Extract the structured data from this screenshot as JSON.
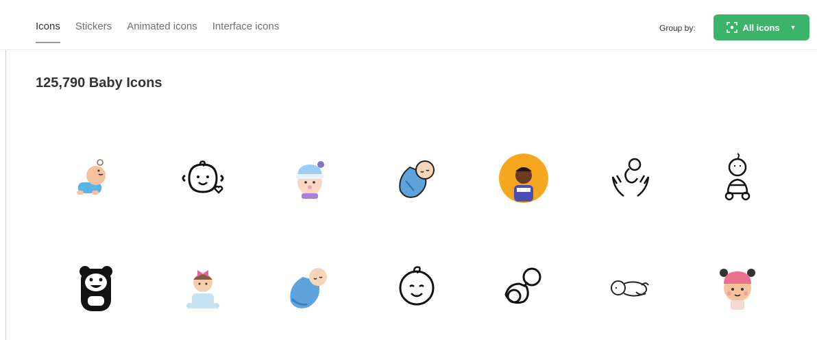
{
  "tabs": [
    {
      "label": "Icons",
      "active": true
    },
    {
      "label": "Stickers",
      "active": false
    },
    {
      "label": "Animated icons",
      "active": false
    },
    {
      "label": "Interface icons",
      "active": false
    }
  ],
  "group_by": {
    "label": "Group by:",
    "button_label": "All icons",
    "button_icon": "grid-focus-icon",
    "color": "#3bb36b"
  },
  "page_title": "125,790 Baby Icons",
  "icons": [
    {
      "name": "crawling-baby-icon"
    },
    {
      "name": "baby-face-heart-icon"
    },
    {
      "name": "baby-winter-hat-icon"
    },
    {
      "name": "swaddled-baby-icon"
    },
    {
      "name": "baby-avatar-icon"
    },
    {
      "name": "hands-holding-baby-icon"
    },
    {
      "name": "sitting-baby-icon"
    },
    {
      "name": "teddy-bear-icon"
    },
    {
      "name": "baby-girl-bow-icon"
    },
    {
      "name": "wrapped-baby-icon"
    },
    {
      "name": "baby-face-icon"
    },
    {
      "name": "pacifier-icon"
    },
    {
      "name": "newborn-baby-icon"
    },
    {
      "name": "baby-pink-hat-icon"
    }
  ]
}
